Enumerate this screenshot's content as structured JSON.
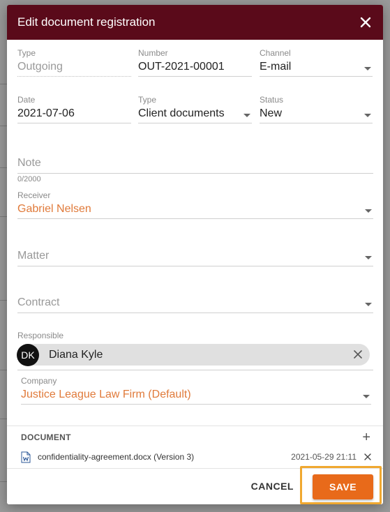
{
  "dialog": {
    "title": "Edit document registration"
  },
  "fields": {
    "type_direction": {
      "label": "Type",
      "value": "Outgoing"
    },
    "number": {
      "label": "Number",
      "value": "OUT-2021-00001"
    },
    "channel": {
      "label": "Channel",
      "value": "E-mail"
    },
    "date": {
      "label": "Date",
      "value": "2021-07-06"
    },
    "type_category": {
      "label": "Type",
      "value": "Client documents"
    },
    "status": {
      "label": "Status",
      "value": "New"
    },
    "note": {
      "placeholder": "Note",
      "counter": "0/2000"
    },
    "receiver": {
      "label": "Receiver",
      "value": "Gabriel Nelsen"
    },
    "matter": {
      "placeholder": "Matter"
    },
    "contract": {
      "placeholder": "Contract"
    },
    "responsible": {
      "label": "Responsible",
      "initials": "DK",
      "name": "Diana Kyle"
    },
    "company": {
      "label": "Company",
      "value": "Justice League Law Firm (Default)"
    }
  },
  "document": {
    "heading": "DOCUMENT",
    "file": "confidentiality-agreement.docx (Version 3)",
    "timestamp": "2021-05-29 21:11",
    "icon": "word-doc-icon"
  },
  "footer": {
    "cancel_label": "CANCEL",
    "save_label": "SAVE"
  },
  "colors": {
    "header": "#5a0a1a",
    "accent": "#e86a1a",
    "highlight": "#f0a830"
  }
}
